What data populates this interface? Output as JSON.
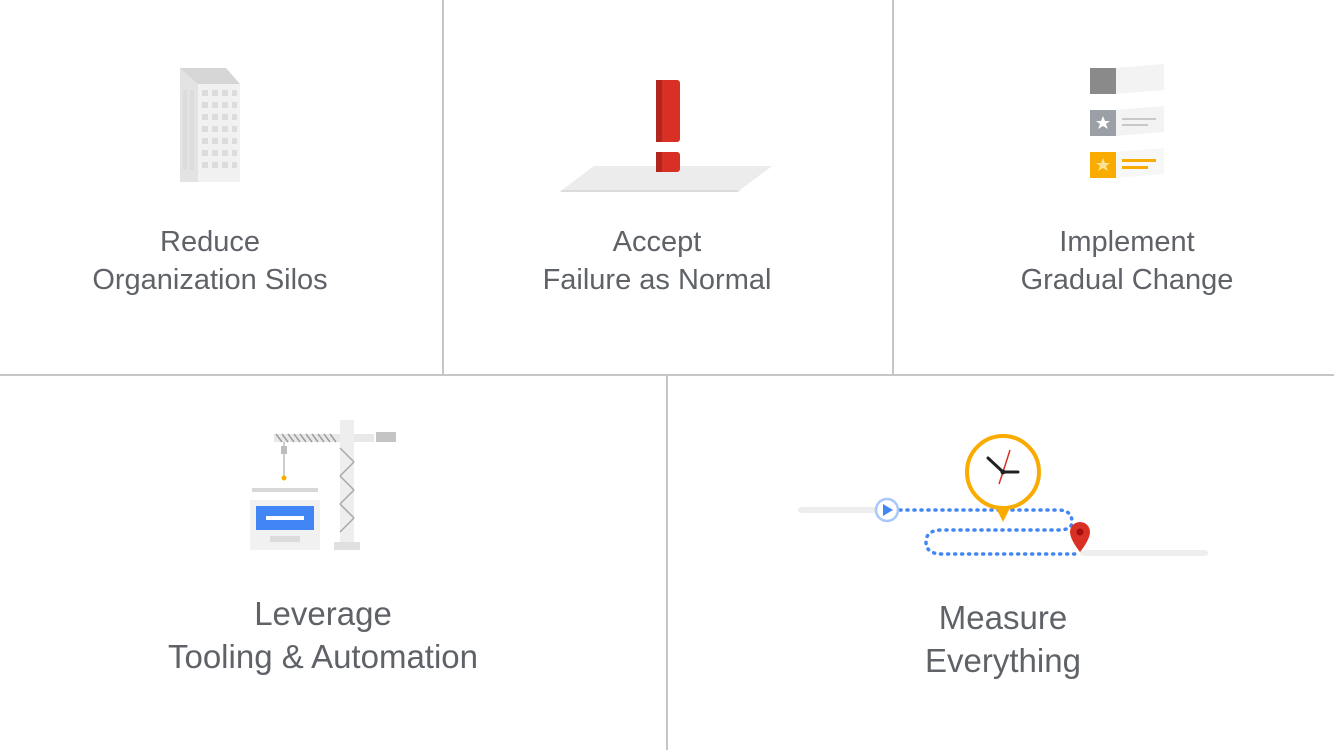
{
  "tiles": [
    {
      "line1": "Reduce",
      "line2": "Organization Silos",
      "icon": "office-building-icon"
    },
    {
      "line1": "Accept",
      "line2": "Failure as Normal",
      "icon": "exclamation-mark-icon"
    },
    {
      "line1": "Implement",
      "line2": "Gradual Change",
      "icon": "stacked-cards-icon"
    },
    {
      "line1": "Leverage",
      "line2": "Tooling & Automation",
      "icon": "construction-crane-icon"
    },
    {
      "line1": "Measure",
      "line2": "Everything",
      "icon": "clock-route-icon"
    }
  ],
  "colors": {
    "text": "#5f6368",
    "divider": "#c6c6c6",
    "red": "#d93025",
    "yellow": "#f9ab00",
    "blue": "#4285f4",
    "gray": "#9aa0a6"
  }
}
